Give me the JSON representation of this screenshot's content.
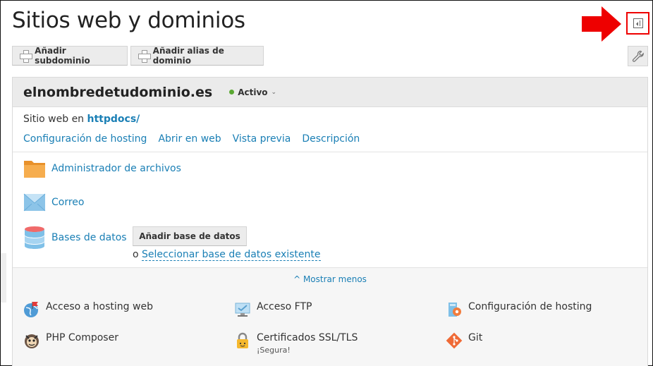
{
  "page": {
    "title": "Sitios web y dominios"
  },
  "toolbar": {
    "add_subdomain": "Añadir subdominio",
    "add_alias": "Añadir alias de dominio"
  },
  "domain": {
    "name": "elnombredetudominio.es",
    "status": "Activo",
    "site_prefix": "Sitio web en",
    "site_path": "httpdocs/",
    "links": [
      "Configuración de hosting",
      "Abrir en web",
      "Vista previa",
      "Descripción"
    ],
    "features": {
      "file_manager": "Administrador de archivos",
      "mail": "Correo",
      "databases": "Bases de datos",
      "add_database": "Añadir base de datos",
      "or_label": "o",
      "select_database": "Seleccionar base de datos existente"
    },
    "show_less": "Mostrar menos",
    "tools": [
      {
        "label": "Acceso a hosting web",
        "icon": "globe-flag-icon"
      },
      {
        "label": "Acceso FTP",
        "icon": "ftp-monitor-icon"
      },
      {
        "label": "Configuración de hosting",
        "icon": "hosting-settings-icon"
      },
      {
        "label": "PHP Composer",
        "icon": "composer-icon"
      },
      {
        "label": "Certificados SSL/TLS",
        "icon": "padlock-icon",
        "sub": "¡Segura!"
      },
      {
        "label": "Git",
        "icon": "git-icon"
      }
    ]
  },
  "colors": {
    "link": "#1a7fb5",
    "status_active": "#5aa832",
    "highlight": "#ee0000"
  }
}
